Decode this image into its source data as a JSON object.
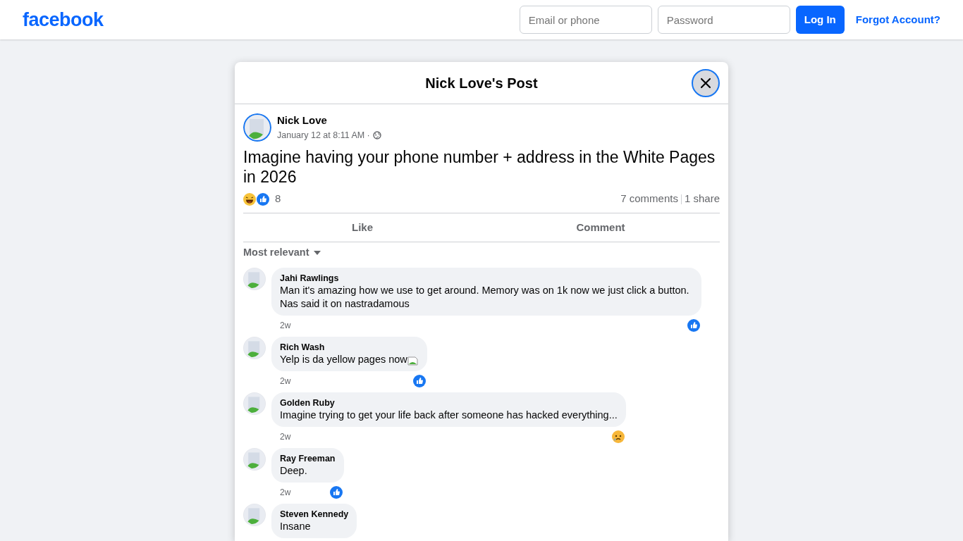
{
  "navbar": {
    "logo": "facebook",
    "email_placeholder": "Email or phone",
    "password_placeholder": "Password",
    "login_button": "Log In",
    "forgot_link": "Forgot Account?"
  },
  "post": {
    "title": "Nick Love's Post",
    "author": "Nick Love",
    "time": "January 12 at 8:11 AM",
    "separator": "·",
    "text": "Imagine having your phone number + address in the White Pages in 2026",
    "reactions": [
      {
        "kind": "haha"
      },
      {
        "kind": "like"
      }
    ],
    "reaction_count": "8",
    "comments_count": "7 comments",
    "shares": "1 share",
    "actions": [
      "Like",
      "Comment"
    ],
    "sort": "Most relevant"
  },
  "comments": [
    {
      "name": "Jahi Rawlings",
      "text": "Man it's amazing how we use to get around. Memory was on 1k now we just click a button. Nas said it on nastradamous",
      "age": "2w",
      "reactions": [
        {
          "kind": "like"
        }
      ],
      "inline_image": false
    },
    {
      "name": "Rich Wash",
      "text": "Yelp is da yellow pages now",
      "age": "2w",
      "reactions": [
        {
          "kind": "like"
        }
      ],
      "inline_image": true
    },
    {
      "name": "Golden Ruby",
      "text": "Imagine trying to get your life back after someone has hacked everything...",
      "age": "2w",
      "reactions": [
        {
          "kind": "sad"
        }
      ],
      "inline_image": false
    },
    {
      "name": "Ray Freeman",
      "text": "Deep.",
      "age": "2w",
      "reactions": [
        {
          "kind": "like"
        }
      ],
      "inline_image": false
    },
    {
      "name": "Steven Kennedy",
      "text": "Insane"
    }
  ]
}
